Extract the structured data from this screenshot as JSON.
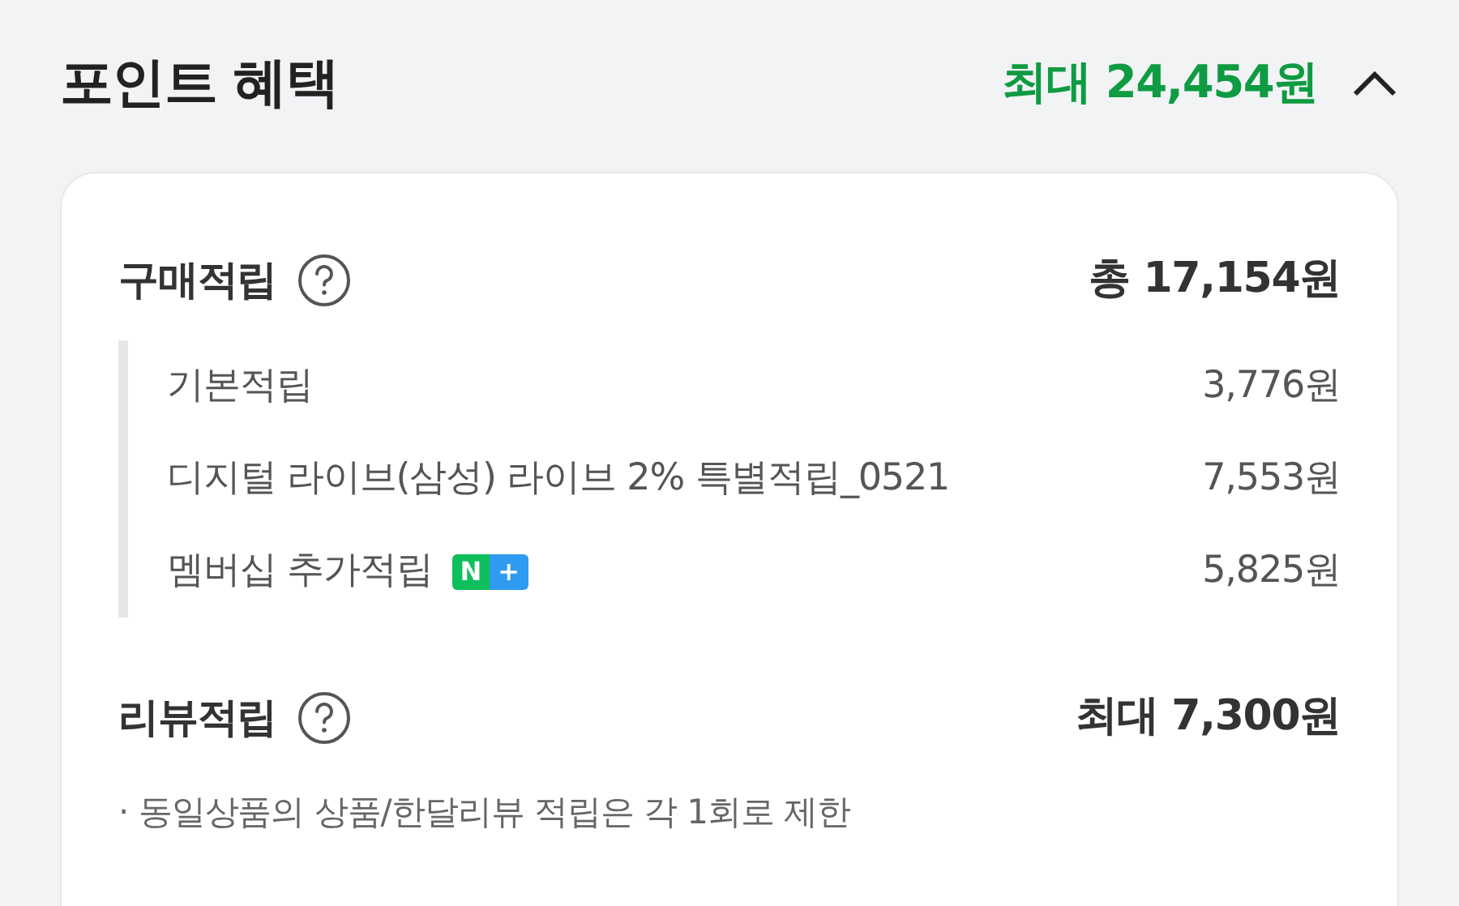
{
  "header": {
    "title": "포인트 혜택",
    "total": "최대 24,454원",
    "expanded": true
  },
  "sections": [
    {
      "title": "구매적립",
      "amount": "총 17,154원",
      "items": [
        {
          "label": "기본적립",
          "amount": "3,776원"
        },
        {
          "label": "디지털 라이브(삼성) 라이브 2% 특별적립_0521",
          "amount": "7,553원"
        },
        {
          "label": "멤버십 추가적립",
          "amount": "5,825원",
          "badge": [
            "N",
            "+"
          ]
        }
      ]
    },
    {
      "title": "리뷰적립",
      "amount": "최대 7,300원",
      "notes": [
        "· 동일상품의 상품/한달리뷰 적립은 각 1회로 제한"
      ]
    }
  ]
}
